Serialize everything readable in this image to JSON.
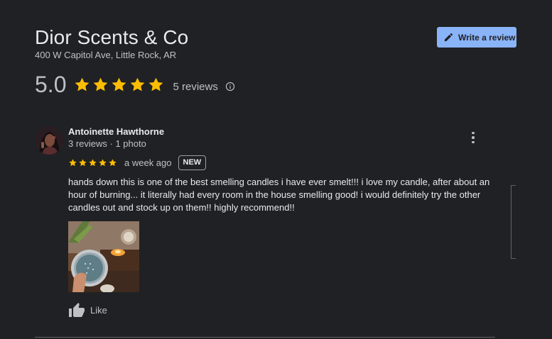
{
  "business": {
    "name": "Dior Scents & Co",
    "address": "400 W Capitol Ave, Little Rock, AR",
    "rating": "5.0",
    "reviews_count": "5 reviews",
    "star_count": 5
  },
  "actions": {
    "write_review_label": "Write a review",
    "like_label": "Like"
  },
  "review": {
    "author": "Antoinette Hawthorne",
    "meta": "3 reviews · 1 photo",
    "stars": 5,
    "time": "a week ago",
    "badge": "NEW",
    "text": "hands down this is one of the best smelling candles i have ever smelt!!! i love my candle, after about an hour of burning... it literally had every room in the house smelling good! i would definitely try the other candles out and stock up on them!! highly recommend!!"
  },
  "colors": {
    "background": "#202124",
    "star": "#fbbc04",
    "accent_button": "#8ab4f8",
    "text_primary": "#e8eaed",
    "text_secondary": "#bdc1c6"
  },
  "icons": [
    "pencil-icon",
    "star-icon",
    "info-icon",
    "more-vert-icon",
    "thumb-up-icon"
  ]
}
